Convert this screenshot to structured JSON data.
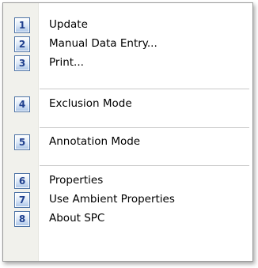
{
  "menu": {
    "items": [
      {
        "num": "1",
        "label": "Update"
      },
      {
        "num": "2",
        "label": "Manual Data Entry..."
      },
      {
        "num": "3",
        "label": "Print..."
      },
      {
        "num": "4",
        "label": "Exclusion Mode"
      },
      {
        "num": "5",
        "label": "Annotation Mode"
      },
      {
        "num": "6",
        "label": "Properties"
      },
      {
        "num": "7",
        "label": "Use Ambient Properties"
      },
      {
        "num": "8",
        "label": "About SPC"
      }
    ]
  },
  "colors": {
    "badge_border": "#4d73a6",
    "badge_text": "#1f3f8e",
    "gutter": "#f1f1ec"
  }
}
